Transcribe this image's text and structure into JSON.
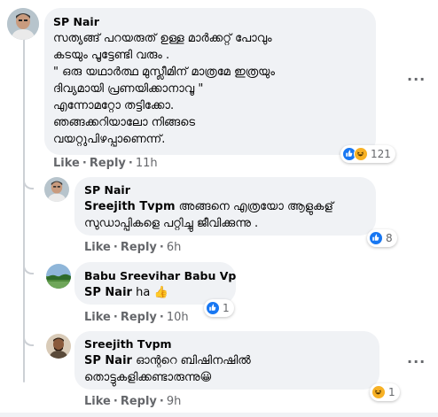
{
  "comments": [
    {
      "author": "SP Nair",
      "lines": [
        "സത്യങ്ങ് പറയരുത് ഉള്ള മാർക്കറ്റ് പോവും",
        "കടയും പൂട്ടേണ്ടി വരും .",
        "\" ഒരു യഥാർത്ഥ മുസ്ലീമിന് മാത്രമേ ഇത്രയും",
        "ദിവ്യമായി പ്രണയിക്കാനാവൂ \"",
        "എന്നോമറ്റോ തട്ടിക്കോ.",
        "ഞങ്ങക്കറിയാലോ നിങ്ങടെ",
        "വയറ്റുപിഴപ്പാണെന്ന്."
      ],
      "like": "Like",
      "reply": "Reply",
      "time": "11h",
      "reaction_count": "121"
    },
    {
      "author": "SP Nair",
      "mention": "Sreejith Tvpm",
      "text1": "അങ്ങനെ എത്രയോ ആളുകള്",
      "text2": "സുഡാപ്പികളെ പറ്റിച്ചു ജീവിക്കുന്നു .",
      "like": "Like",
      "reply": "Reply",
      "time": "6h",
      "reaction_count": "8"
    },
    {
      "author": "Babu Sreevihar Babu Vp",
      "mention": "SP Nair",
      "text1": "ha",
      "like": "Like",
      "reply": "Reply",
      "time": "10h",
      "reaction_count": "1"
    },
    {
      "author": "Sreejith Tvpm",
      "mention": "SP Nair",
      "text1": "ഓന്ററെ ബിഷിനഷിൽ",
      "text2": "തൊട്ടുകളിക്കണ്ടാരുന്നു",
      "like": "Like",
      "reply": "Reply",
      "time": "9h",
      "reaction_count": "1"
    }
  ],
  "more_icon": "more-horizontal-icon",
  "colors": {
    "bubble": "#f0f2f5",
    "meta": "#65676b",
    "like_blue": "#1877f2",
    "haha_yellow": "#f7b125"
  }
}
